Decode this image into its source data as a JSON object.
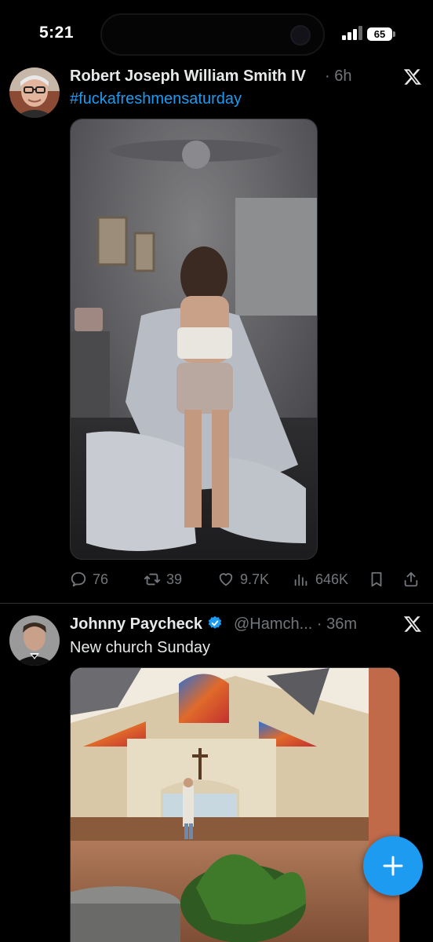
{
  "status_bar": {
    "time": "5:21",
    "battery": "65",
    "island_ghost_text": "",
    "icons": [
      "signal-icon",
      "battery-icon"
    ]
  },
  "tweets": [
    {
      "author_name": "Robert Joseph William Smith IV",
      "handle": "",
      "separator": "·",
      "time": "6h",
      "text": "",
      "hashtag": "#fuckafreshmensaturday",
      "verified": false,
      "stats": {
        "replies": "76",
        "reposts": "39",
        "likes": "9.7K",
        "views": "646K"
      }
    },
    {
      "author_name": "Johnny Paycheck",
      "handle": "@Hamch...",
      "separator": "·",
      "time": "36m",
      "text": "New church Sunday",
      "hashtag": "",
      "verified": true
    }
  ],
  "colors": {
    "background": "#000000",
    "text": "#e7e9ea",
    "muted": "#71767b",
    "accent": "#1d9bf0",
    "divider": "#2f3336"
  },
  "fab": {
    "icon": "plus-icon"
  }
}
